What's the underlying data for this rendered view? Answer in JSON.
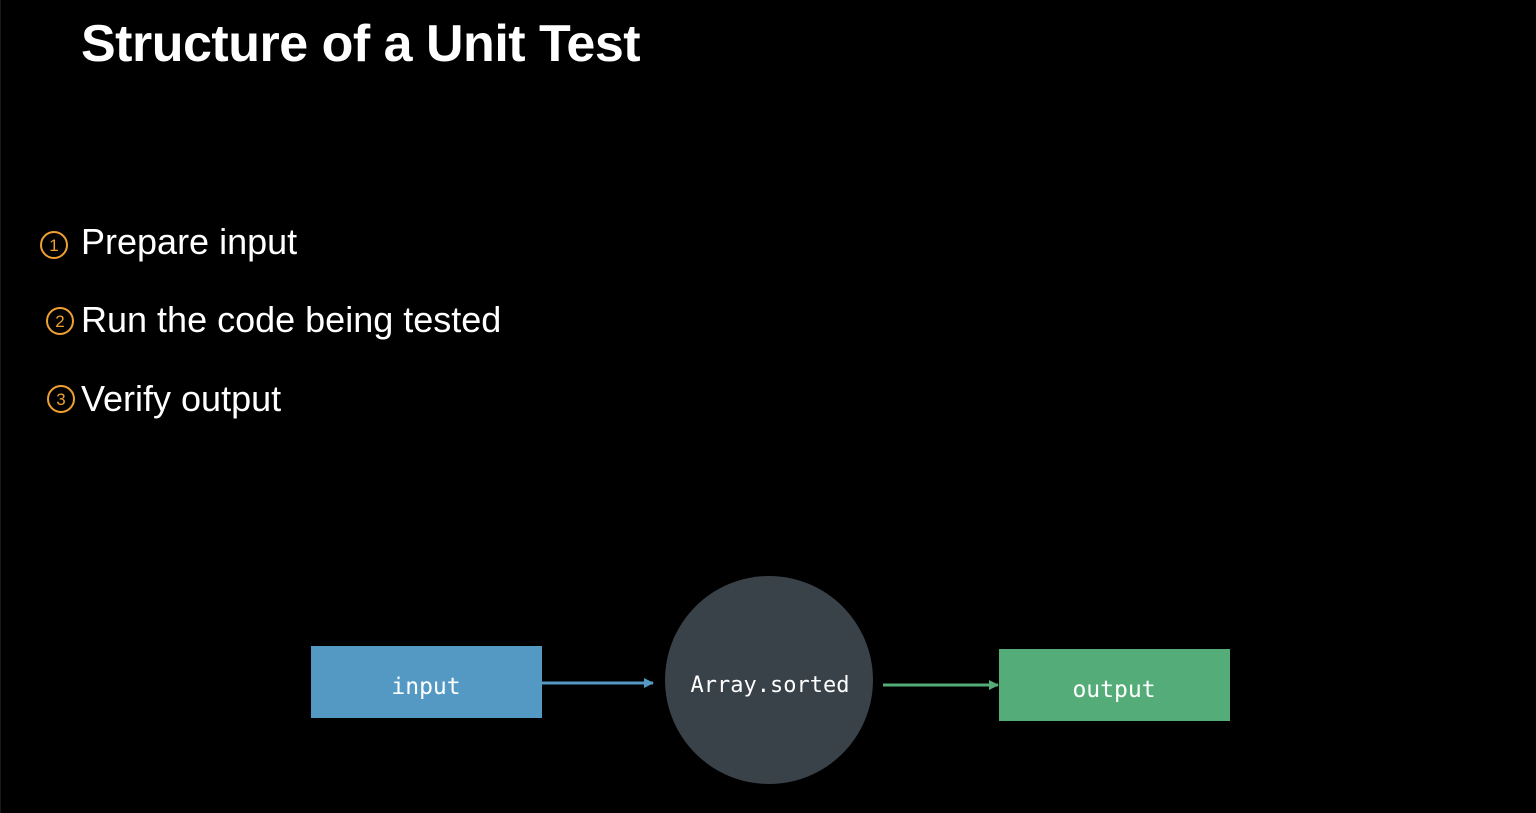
{
  "slide": {
    "title": "Structure of a Unit Test",
    "steps": [
      {
        "marker": "1",
        "text": "Prepare input"
      },
      {
        "marker": "2",
        "text": "Run the code being tested"
      },
      {
        "marker": "3",
        "text": "Verify output"
      }
    ],
    "marker_color": "#f0a030"
  },
  "diagram": {
    "input_label": "input",
    "function_label": "Array.sorted",
    "output_label": "output",
    "colors": {
      "input": "#5399c4",
      "function": "#394149",
      "output": "#54ad79",
      "arrow_in": "#5399c4",
      "arrow_out": "#54ad79"
    }
  }
}
